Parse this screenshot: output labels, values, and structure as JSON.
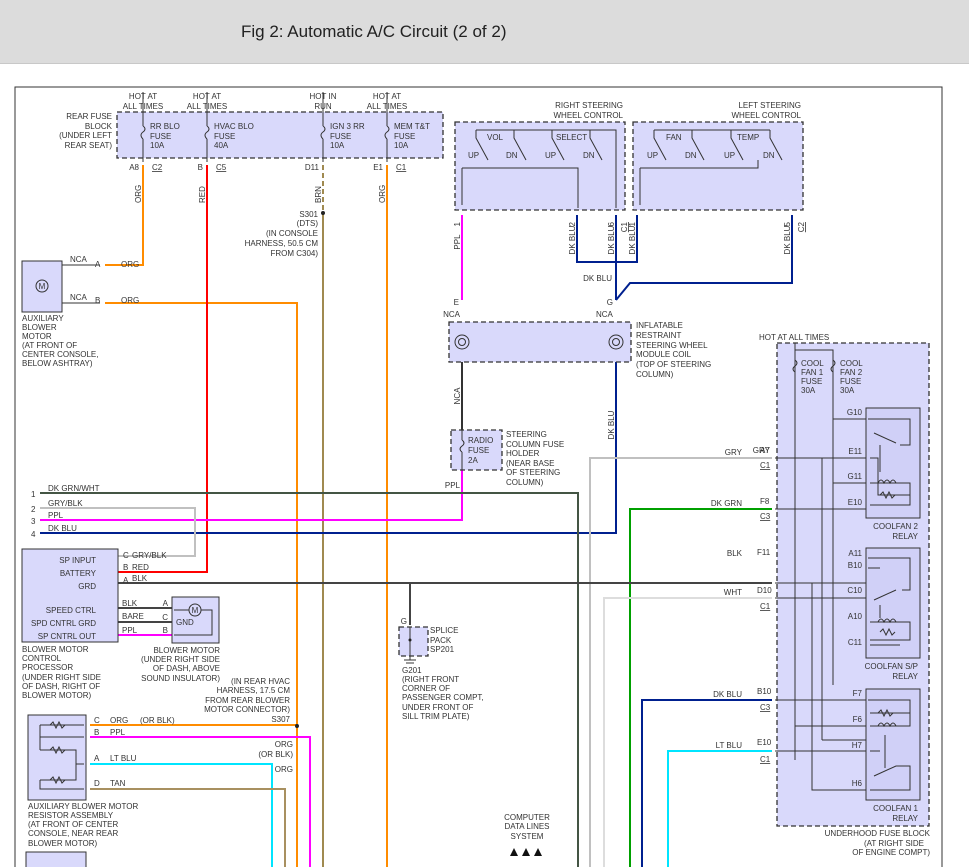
{
  "title": "Fig 2: Automatic A/C Circuit (2 of 2)",
  "colors": {
    "ORG": "#ff8c00",
    "RED": "#ff0000",
    "BRN": "#a08a50",
    "PPL": "#ff00ff",
    "DK_BLU": "#00208f",
    "GRY": "#c0c0c0",
    "DK_GRN": "#00a000",
    "BLK": "#444444",
    "WHT": "#dddddd",
    "LT_BLU": "#00e5ff",
    "TAN": "#a89060",
    "component_fill": "#d9d9fb"
  },
  "rfb": {
    "label": [
      "REAR FUSE",
      "BLOCK",
      "(UNDER LEFT",
      "REAR SEAT)"
    ],
    "fuses": [
      {
        "hot": [
          "HOT AT",
          "ALL TIMES"
        ],
        "name": [
          "RR BLO",
          "FUSE",
          "10A"
        ],
        "pin": "A8",
        "conn": "C2",
        "wire": "ORG"
      },
      {
        "hot": [
          "HOT AT",
          "ALL TIMES"
        ],
        "name": [
          "HVAC BLO",
          "FUSE",
          "40A"
        ],
        "pin": "B",
        "conn": "C5",
        "wire": "RED"
      },
      {
        "hot": [
          "HOT IN",
          "RUN"
        ],
        "name": [
          "IGN 3 RR",
          "FUSE",
          "10A"
        ],
        "pin": "D11",
        "wire": "BRN"
      },
      {
        "hot": [
          "HOT AT",
          "ALL TIMES"
        ],
        "name": [
          "MEM T&T",
          "FUSE",
          "10A"
        ],
        "pin": "E1",
        "conn": "C1",
        "wire": "ORG"
      }
    ]
  },
  "s301": [
    "S301",
    "(DTS)",
    "(IN CONSOLE",
    "HARNESS, 50.5 CM",
    "FROM C304)"
  ],
  "right_swc": {
    "label": [
      "RIGHT STEERING",
      "WHEEL CONTROL"
    ],
    "groups": [
      "VOL",
      "SELECT"
    ],
    "switches": [
      "UP",
      "DN",
      "UP",
      "DN"
    ],
    "pins": [
      "1",
      "2",
      "6"
    ],
    "conn": "C1",
    "wires": [
      "PPL",
      "DK BLU",
      "DK BLU"
    ]
  },
  "left_swc": {
    "label": [
      "LEFT STEERING",
      "WHEEL CONTROL"
    ],
    "groups": [
      "FAN",
      "TEMP"
    ],
    "switches": [
      "UP",
      "DN",
      "UP",
      "DN"
    ],
    "pins": [
      "1",
      "5"
    ],
    "conn": "C2",
    "wires": [
      "DK BLU",
      "DK BLU"
    ]
  },
  "dk_blu_label": "DK BLU",
  "coil": {
    "pins": [
      "E",
      "G"
    ],
    "nca": [
      "NCA",
      "NCA"
    ],
    "label": [
      "INFLATABLE",
      "RESTRAINT",
      "STEERING WHEEL",
      "MODULE COIL",
      "(TOP OF STEERING",
      "COLUMN)"
    ],
    "wires": [
      "NCA",
      "DK BLU"
    ]
  },
  "radio_fuse": {
    "name": [
      "RADIO",
      "FUSE",
      "2A"
    ],
    "label": [
      "STEERING",
      "COLUMN FUSE",
      "HOLDER",
      "(NEAR BASE",
      "OF STEERING",
      "COLUMN)"
    ],
    "wire": "PPL"
  },
  "aux_motor": {
    "glyph": "M",
    "pins": [
      {
        "nca": "NCA",
        "pin": "A",
        "wire": "ORG"
      },
      {
        "nca": "NCA",
        "pin": "B",
        "wire": "ORG"
      }
    ],
    "label": [
      "AUXILIARY",
      "BLOWER",
      "MOTOR",
      "(AT FRONT OF",
      "CENTER CONSOLE,",
      "BELOW ASHTRAY)"
    ]
  },
  "left_lines": [
    {
      "num": "1",
      "wire": "DK GRN/WHT"
    },
    {
      "num": "2",
      "wire": "GRY/BLK"
    },
    {
      "num": "3",
      "wire": "PPL"
    },
    {
      "num": "4",
      "wire": "DK BLU"
    }
  ],
  "bmcp": {
    "pins": [
      {
        "name": "SP INPUT",
        "pin": "C",
        "wire": "GRY/BLK"
      },
      {
        "name": "BATTERY",
        "pin": "B",
        "wire": "RED"
      },
      {
        "name": "GRD",
        "pin": "A",
        "wire": "BLK"
      },
      {
        "name": "SPEED CTRL",
        "wire": "BLK"
      },
      {
        "name": "SPD CNTRL GRD",
        "wire": "BARE"
      },
      {
        "name": "SP CNTRL OUT",
        "wire": "PPL"
      }
    ],
    "label": [
      "BLOWER MOTOR",
      "CONTROL",
      "PROCESSOR",
      "(UNDER RIGHT SIDE",
      "OF DASH, RIGHT OF",
      "BLOWER MOTOR)"
    ]
  },
  "blower_motor": {
    "glyph": "M",
    "pins": [
      "A",
      "C",
      "B"
    ],
    "gnd": "GND",
    "label": [
      "BLOWER MOTOR",
      "(UNDER RIGHT SIDE",
      "OF DASH, ABOVE",
      "SOUND INSULATOR)"
    ]
  },
  "splice": {
    "pin": "G",
    "name": [
      "SPLICE",
      "PACK",
      "SP201"
    ],
    "ground": [
      "G201",
      "(RIGHT FRONT",
      "CORNER OF",
      "PASSENGER COMPT,",
      "UNDER FRONT OF",
      "SILL TRIM PLATE)"
    ]
  },
  "s307": {
    "label": [
      "(IN REAR HVAC",
      "HARNESS, 17.5 CM",
      "FROM REAR BLOWER",
      "MOTOR CONNECTOR)",
      "S307"
    ],
    "upper": [
      "ORG",
      "(OR BLK)"
    ],
    "lower": "ORG"
  },
  "resistor": {
    "pins": [
      {
        "pin": "C",
        "wire": "ORG",
        "alt": "(OR BLK)"
      },
      {
        "pin": "B",
        "wire": "PPL"
      },
      {
        "pin": "A",
        "wire": "LT BLU"
      },
      {
        "pin": "D",
        "wire": "TAN"
      }
    ],
    "label": [
      "AUXILIARY BLOWER MOTOR",
      "RESISTOR ASSEMBLY",
      "(AT FRONT OF CENTER",
      "CONSOLE, NEAR REAR",
      "BLOWER MOTOR)"
    ]
  },
  "cdl": [
    "COMPUTER",
    "DATA LINES",
    "SYSTEM"
  ],
  "underhood": {
    "hot": "HOT AT ALL TIMES",
    "fuses": [
      [
        "COOL",
        "FAN 1",
        "FUSE",
        "30A"
      ],
      [
        "COOL",
        "FAN 2",
        "FUSE",
        "30A"
      ]
    ],
    "connectors": [
      {
        "pin": "A7",
        "conn": "C1",
        "wire": "GRY"
      },
      {
        "pin": "F8",
        "conn": "C3",
        "wire": "DK GRN"
      },
      {
        "pin": "F11",
        "wire": "BLK"
      },
      {
        "pin": "D10",
        "conn": "C1",
        "wire": "WHT"
      },
      {
        "pin": "B10",
        "conn": "C3",
        "wire": "DK BLU"
      },
      {
        "pin": "E10",
        "conn": "C1",
        "wire": "LT BLU"
      }
    ],
    "relays": [
      {
        "pins": [
          "G10",
          "E11",
          "G11",
          "E10"
        ],
        "label": [
          "COOLFAN 2",
          "RELAY"
        ]
      },
      {
        "pins": [
          "A11",
          "B10",
          "C10",
          "A10",
          "C11"
        ],
        "label": [
          "COOLFAN S/P",
          "RELAY"
        ]
      },
      {
        "pins": [
          "F7",
          "F6",
          "H7",
          "H6"
        ],
        "label": [
          "COOLFAN 1",
          "RELAY"
        ]
      }
    ],
    "label": [
      "UNDERHOOD FUSE BLOCK",
      "(AT RIGHT SIDE",
      "OF ENGINE COMPT)"
    ]
  }
}
